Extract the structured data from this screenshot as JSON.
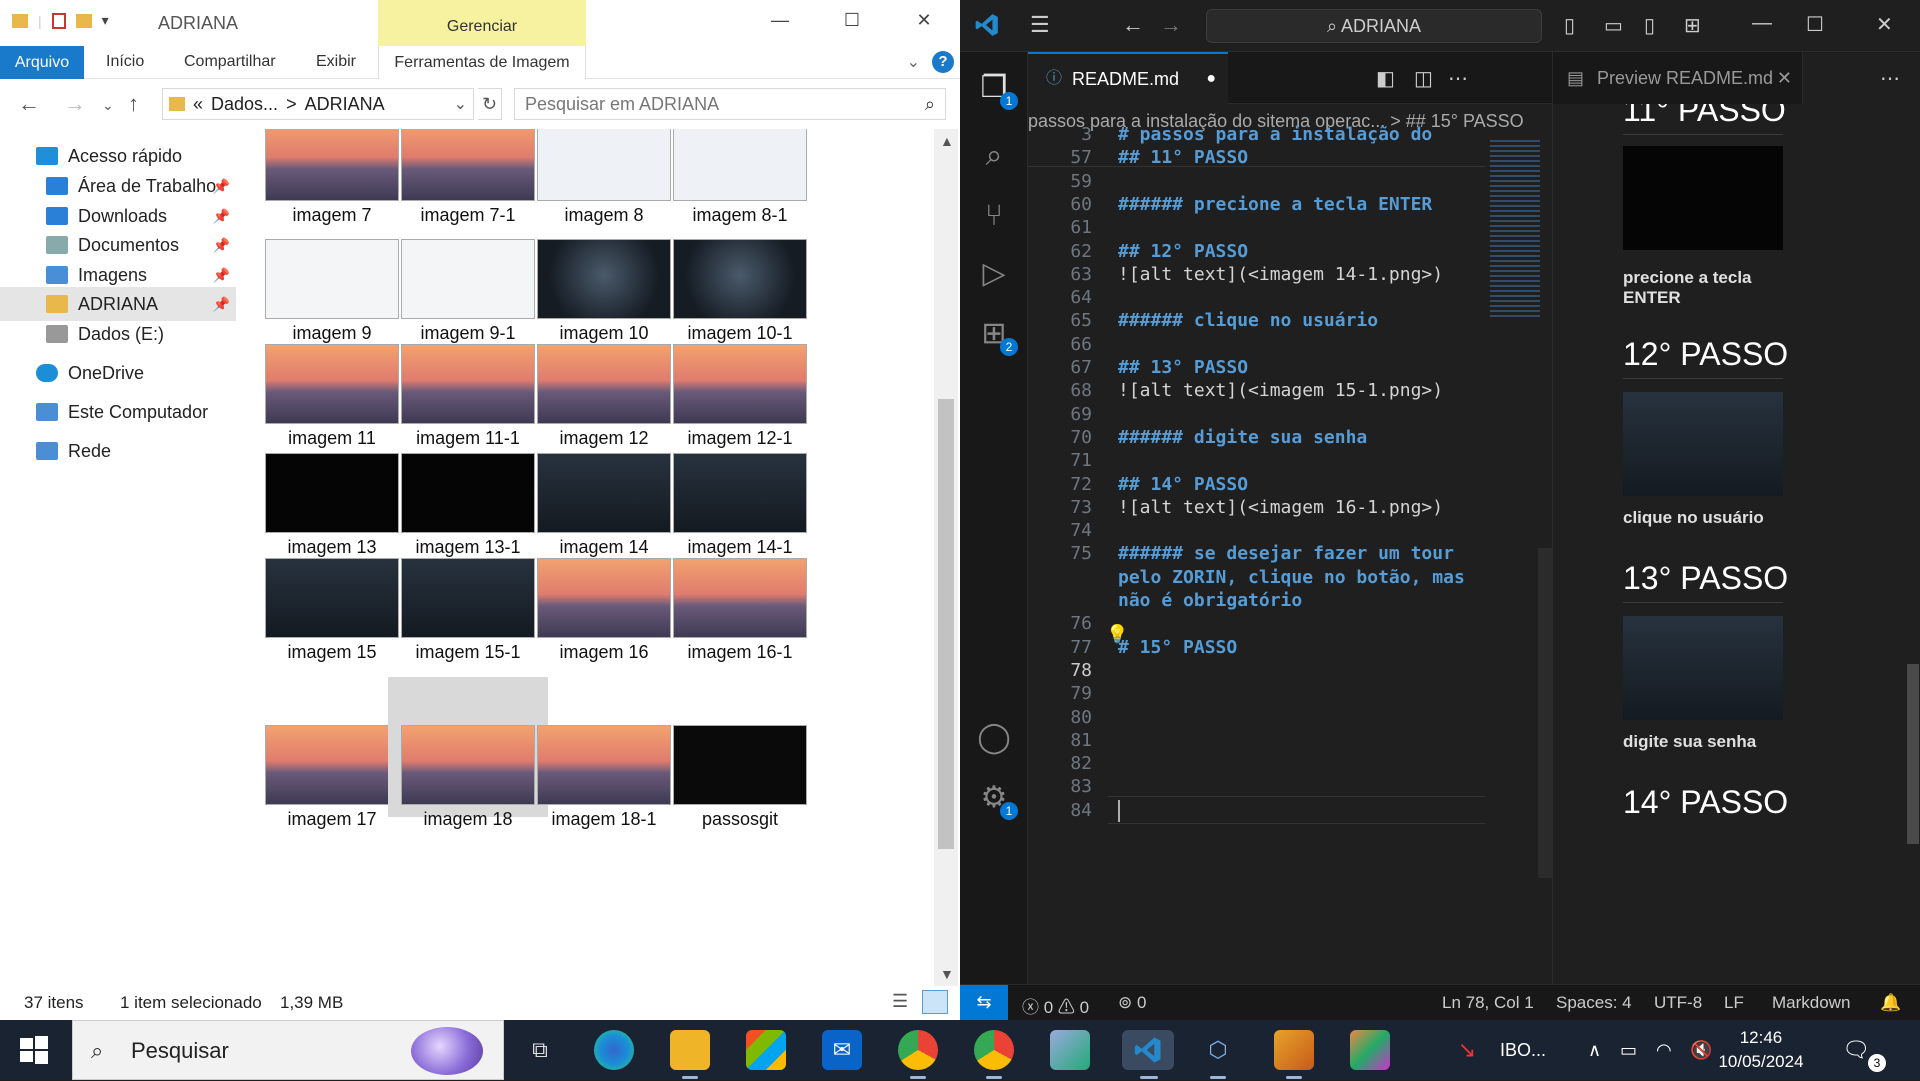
{
  "explorer": {
    "title": "ADRIANA",
    "manage_label": "Gerenciar",
    "ribbon": {
      "file": "Arquivo",
      "home": "Início",
      "share": "Compartilhar",
      "view": "Exibir",
      "tools": "Ferramentas de Imagem"
    },
    "address": {
      "prefix": "«",
      "part1": "Dados...",
      "sep": ">",
      "part2": "ADRIANA"
    },
    "search_placeholder": "Pesquisar em ADRIANA",
    "nav": [
      {
        "label": "Acesso rápido",
        "icon": "star-icon"
      },
      {
        "label": "Área de Trabalho",
        "icon": "desktop-icon"
      },
      {
        "label": "Downloads",
        "icon": "download-icon"
      },
      {
        "label": "Documentos",
        "icon": "document-icon"
      },
      {
        "label": "Imagens",
        "icon": "pictures-icon"
      },
      {
        "label": "ADRIANA",
        "icon": "folder-icon"
      },
      {
        "label": "Dados (E:)",
        "icon": "drive-icon"
      },
      {
        "label": "OneDrive",
        "icon": "cloud-icon"
      },
      {
        "label": "Este Computador",
        "icon": "computer-icon"
      },
      {
        "label": "Rede",
        "icon": "network-icon"
      }
    ],
    "files": [
      {
        "name": "imagem 7",
        "style": "mtn"
      },
      {
        "name": "imagem 7-1",
        "style": "mtn"
      },
      {
        "name": "imagem 8",
        "style": "map"
      },
      {
        "name": "imagem 8-1",
        "style": "map"
      },
      {
        "name": "imagem 9",
        "style": "white"
      },
      {
        "name": "imagem 9-1",
        "style": "white"
      },
      {
        "name": "imagem 10",
        "style": "zorin"
      },
      {
        "name": "imagem 10-1",
        "style": "zorin"
      },
      {
        "name": "imagem 11",
        "style": "mtn"
      },
      {
        "name": "imagem 11-1",
        "style": "mtn"
      },
      {
        "name": "imagem 12",
        "style": "mtn"
      },
      {
        "name": "imagem 12-1",
        "style": "mtn"
      },
      {
        "name": "imagem 13",
        "style": "black"
      },
      {
        "name": "imagem 13-1",
        "style": "black"
      },
      {
        "name": "imagem 14",
        "style": "dark"
      },
      {
        "name": "imagem 14-1",
        "style": "dark"
      },
      {
        "name": "imagem 15",
        "style": "dark"
      },
      {
        "name": "imagem 15-1",
        "style": "dark"
      },
      {
        "name": "imagem 16",
        "style": "mtn"
      },
      {
        "name": "imagem 16-1",
        "style": "mtn"
      },
      {
        "name": "imagem 17",
        "style": "mtn"
      },
      {
        "name": "imagem 18",
        "style": "mtn"
      },
      {
        "name": "imagem 18-1",
        "style": "mtn"
      },
      {
        "name": "passosgit",
        "style": "term"
      }
    ],
    "selected_file": "imagem 18",
    "status": {
      "count": "37 itens",
      "selected": "1 item selecionado",
      "size": "1,39 MB"
    }
  },
  "vscode": {
    "command_center": "ADRIANA",
    "tab": "README.md",
    "breadcrumb": "passos para a instalação do sitema operac... > ## 15° PASSO",
    "lines": [
      {
        "n": "3",
        "text": "# passos para a instalação do",
        "kind": "h"
      },
      {
        "n": "57",
        "text": "## 11° PASSO",
        "kind": "h"
      },
      {
        "n": "59",
        "text": "",
        "kind": "t"
      },
      {
        "n": "60",
        "text": "###### precione a tecla ENTER",
        "kind": "h"
      },
      {
        "n": "61",
        "text": "",
        "kind": "t"
      },
      {
        "n": "62",
        "text": "## 12° PASSO",
        "kind": "h"
      },
      {
        "n": "63",
        "text": "![alt text](<imagem 14-1.png>)",
        "kind": "t"
      },
      {
        "n": "64",
        "text": "",
        "kind": "t"
      },
      {
        "n": "65",
        "text": "###### clique no usuário",
        "kind": "h"
      },
      {
        "n": "66",
        "text": "",
        "kind": "t"
      },
      {
        "n": "67",
        "text": "## 13° PASSO",
        "kind": "h"
      },
      {
        "n": "68",
        "text": "![alt text](<imagem 15-1.png>)",
        "kind": "t"
      },
      {
        "n": "69",
        "text": "",
        "kind": "t"
      },
      {
        "n": "70",
        "text": "###### digite sua senha",
        "kind": "h"
      },
      {
        "n": "71",
        "text": "",
        "kind": "t"
      },
      {
        "n": "72",
        "text": "## 14° PASSO",
        "kind": "h"
      },
      {
        "n": "73",
        "text": "![alt text](<imagem 16-1.png>)",
        "kind": "t"
      },
      {
        "n": "74",
        "text": "",
        "kind": "t"
      },
      {
        "n": "75",
        "text": "###### se desejar fazer um tour",
        "kind": "h"
      },
      {
        "n": "",
        "text": "pelo ZORIN, clique no botão, mas",
        "kind": "h"
      },
      {
        "n": "",
        "text": "não é obrigatório",
        "kind": "h"
      },
      {
        "n": "76",
        "text": "",
        "kind": "t"
      },
      {
        "n": "77",
        "text": "# 15° PASSO",
        "kind": "h"
      },
      {
        "n": "78",
        "text": "",
        "kind": "t"
      },
      {
        "n": "79",
        "text": "",
        "kind": "t"
      },
      {
        "n": "80",
        "text": "",
        "kind": "t"
      },
      {
        "n": "81",
        "text": "",
        "kind": "t"
      },
      {
        "n": "82",
        "text": "",
        "kind": "t"
      },
      {
        "n": "83",
        "text": "",
        "kind": "t"
      },
      {
        "n": "84",
        "text": "",
        "kind": "t"
      }
    ],
    "preview": {
      "tab": "Preview README.md",
      "h11": "11° PASSO",
      "t11": "precione a tecla ENTER",
      "h12": "12° PASSO",
      "t12": "clique no usuário",
      "h13": "13° PASSO",
      "t13": "digite sua senha",
      "h14": "14° PASSO"
    },
    "badges": {
      "explorer": "1",
      "extensions": "2",
      "settings": "1"
    },
    "status": {
      "problems": "0",
      "warnings": "0",
      "ports": "0",
      "position": "Ln 78, Col 1",
      "spaces": "Spaces: 4",
      "encoding": "UTF-8",
      "eol": "LF",
      "language": "Markdown"
    }
  },
  "taskbar": {
    "search": "Pesquisar",
    "ibo_label": "IBO...",
    "time": "12:46",
    "date": "10/05/2024",
    "notifications": "3"
  }
}
